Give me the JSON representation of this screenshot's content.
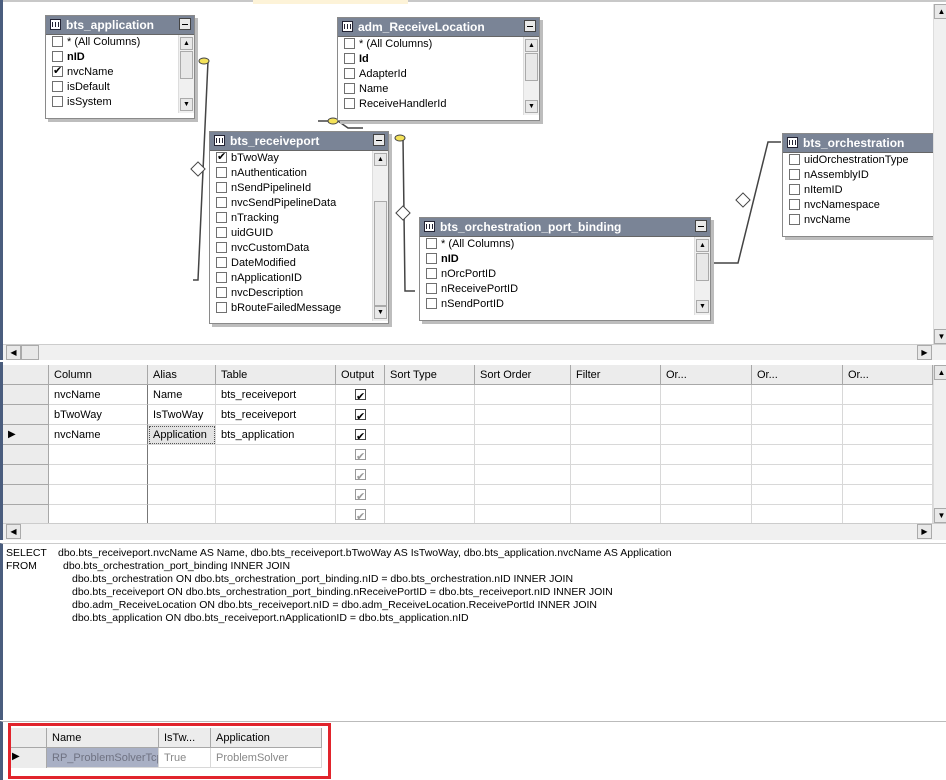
{
  "diagram": {
    "tables": [
      {
        "id": "bts_application",
        "title": "bts_application",
        "rows": [
          {
            "label": "* (All Columns)",
            "checked": false,
            "key": false
          },
          {
            "label": "nID",
            "checked": false,
            "key": true
          },
          {
            "label": "nvcName",
            "checked": true,
            "key": false
          },
          {
            "label": "isDefault",
            "checked": false,
            "key": false
          },
          {
            "label": "isSystem",
            "checked": false,
            "key": false
          }
        ]
      },
      {
        "id": "adm_ReceiveLocation",
        "title": "adm_ReceiveLocation",
        "rows": [
          {
            "label": "* (All Columns)",
            "checked": false,
            "key": false
          },
          {
            "label": "Id",
            "checked": false,
            "key": true
          },
          {
            "label": "AdapterId",
            "checked": false,
            "key": false
          },
          {
            "label": "Name",
            "checked": false,
            "key": false
          },
          {
            "label": "ReceiveHandlerId",
            "checked": false,
            "key": false
          }
        ]
      },
      {
        "id": "bts_receiveport",
        "title": "bts_receiveport",
        "rows": [
          {
            "label": "bTwoWay",
            "checked": true,
            "key": false
          },
          {
            "label": "nAuthentication",
            "checked": false,
            "key": false
          },
          {
            "label": "nSendPipelineId",
            "checked": false,
            "key": false
          },
          {
            "label": "nvcSendPipelineData",
            "checked": false,
            "key": false
          },
          {
            "label": "nTracking",
            "checked": false,
            "key": false
          },
          {
            "label": "uidGUID",
            "checked": false,
            "key": false
          },
          {
            "label": "nvcCustomData",
            "checked": false,
            "key": false
          },
          {
            "label": "DateModified",
            "checked": false,
            "key": false
          },
          {
            "label": "nApplicationID",
            "checked": false,
            "key": false
          },
          {
            "label": "nvcDescription",
            "checked": false,
            "key": false
          },
          {
            "label": "bRouteFailedMessage",
            "checked": false,
            "key": false
          }
        ]
      },
      {
        "id": "bts_orchestration_port_binding",
        "title": "bts_orchestration_port_binding",
        "rows": [
          {
            "label": "* (All Columns)",
            "checked": false,
            "key": false
          },
          {
            "label": "nID",
            "checked": false,
            "key": true
          },
          {
            "label": "nOrcPortID",
            "checked": false,
            "key": false
          },
          {
            "label": "nReceivePortID",
            "checked": false,
            "key": false
          },
          {
            "label": "nSendPortID",
            "checked": false,
            "key": false
          }
        ]
      },
      {
        "id": "bts_orchestration",
        "title": "bts_orchestration",
        "rows": [
          {
            "label": "uidOrchestrationType",
            "checked": false,
            "key": false
          },
          {
            "label": "nAssemblyID",
            "checked": false,
            "key": false
          },
          {
            "label": "nItemID",
            "checked": false,
            "key": false
          },
          {
            "label": "nvcNamespace",
            "checked": false,
            "key": false
          },
          {
            "label": "nvcName",
            "checked": false,
            "key": false
          }
        ]
      }
    ]
  },
  "grid": {
    "headers": [
      "Column",
      "Alias",
      "Table",
      "Output",
      "Sort Type",
      "Sort Order",
      "Filter",
      "Or...",
      "Or...",
      "Or..."
    ],
    "rows": [
      {
        "column": "nvcName",
        "alias": "Name",
        "table": "bts_receiveport",
        "output": true,
        "current": false
      },
      {
        "column": "bTwoWay",
        "alias": "IsTwoWay",
        "table": "bts_receiveport",
        "output": true,
        "current": false
      },
      {
        "column": "nvcName",
        "alias": "Application",
        "table": "bts_application",
        "output": true,
        "current": true
      },
      {
        "column": "",
        "alias": "",
        "table": "",
        "output": "dim",
        "current": false
      },
      {
        "column": "",
        "alias": "",
        "table": "",
        "output": "dim",
        "current": false
      },
      {
        "column": "",
        "alias": "",
        "table": "",
        "output": "dim",
        "current": false
      },
      {
        "column": "",
        "alias": "",
        "table": "",
        "output": "dim",
        "current": false
      }
    ]
  },
  "sql": {
    "lines": [
      {
        "kw": "SELECT",
        "text": "dbo.bts_receiveport.nvcName AS Name, dbo.bts_receiveport.bTwoWay AS IsTwoWay, dbo.bts_application.nvcName AS Application"
      },
      {
        "kw": "FROM",
        "text": "dbo.bts_orchestration_port_binding INNER JOIN"
      },
      {
        "kw": "",
        "text": "dbo.bts_orchestration ON dbo.bts_orchestration_port_binding.nID = dbo.bts_orchestration.nID INNER JOIN"
      },
      {
        "kw": "",
        "text": "dbo.bts_receiveport ON dbo.bts_orchestration_port_binding.nReceivePortID = dbo.bts_receiveport.nID INNER JOIN"
      },
      {
        "kw": "",
        "text": "dbo.adm_ReceiveLocation ON dbo.bts_receiveport.nID = dbo.adm_ReceiveLocation.ReceivePortId INNER JOIN"
      },
      {
        "kw": "",
        "text": "dbo.bts_application ON dbo.bts_receiveport.nApplicationID = dbo.bts_application.nID"
      }
    ]
  },
  "results": {
    "headers": [
      "Name",
      "IsTw...",
      "Application"
    ],
    "row": [
      "RP_ProblemSolverTcp",
      "True",
      "ProblemSolver"
    ]
  },
  "colors": {
    "highlight": "#e1242c",
    "header": "#7a8496"
  }
}
